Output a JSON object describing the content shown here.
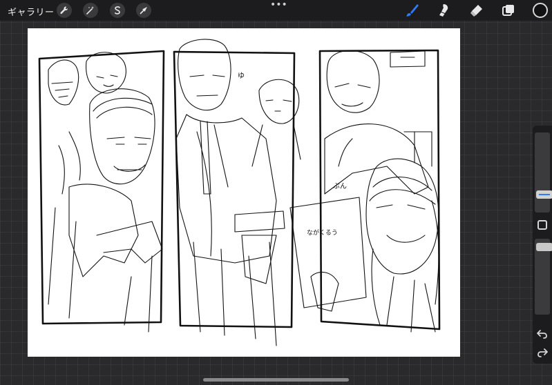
{
  "topbar": {
    "gallery_label": "ギャラリー",
    "left_tools": [
      {
        "name": "actions",
        "icon": "wrench-icon"
      },
      {
        "name": "adjustments",
        "icon": "magic-wand-icon"
      },
      {
        "name": "selection",
        "icon": "selection-s-icon"
      },
      {
        "name": "transform",
        "icon": "arrow-cursor-icon"
      }
    ],
    "more_icon": "ellipsis-icon",
    "right_tools": [
      {
        "name": "paint",
        "icon": "brush-icon",
        "active": true
      },
      {
        "name": "smudge",
        "icon": "smudge-icon",
        "active": false
      },
      {
        "name": "erase",
        "icon": "eraser-icon",
        "active": false
      },
      {
        "name": "layers",
        "icon": "layers-icon",
        "active": false
      }
    ],
    "current_color": "#111111",
    "accent_color": "#2f7cf6"
  },
  "canvas": {
    "description_lines": [
      "ゆ",
      "ぶん",
      "ながくるう"
    ]
  },
  "sidebar": {
    "brush_size": 0.62,
    "opacity": 0.97,
    "modify_icon": "square-icon",
    "undo_icon": "undo-arrow-icon",
    "redo_icon": "redo-arrow-icon"
  }
}
